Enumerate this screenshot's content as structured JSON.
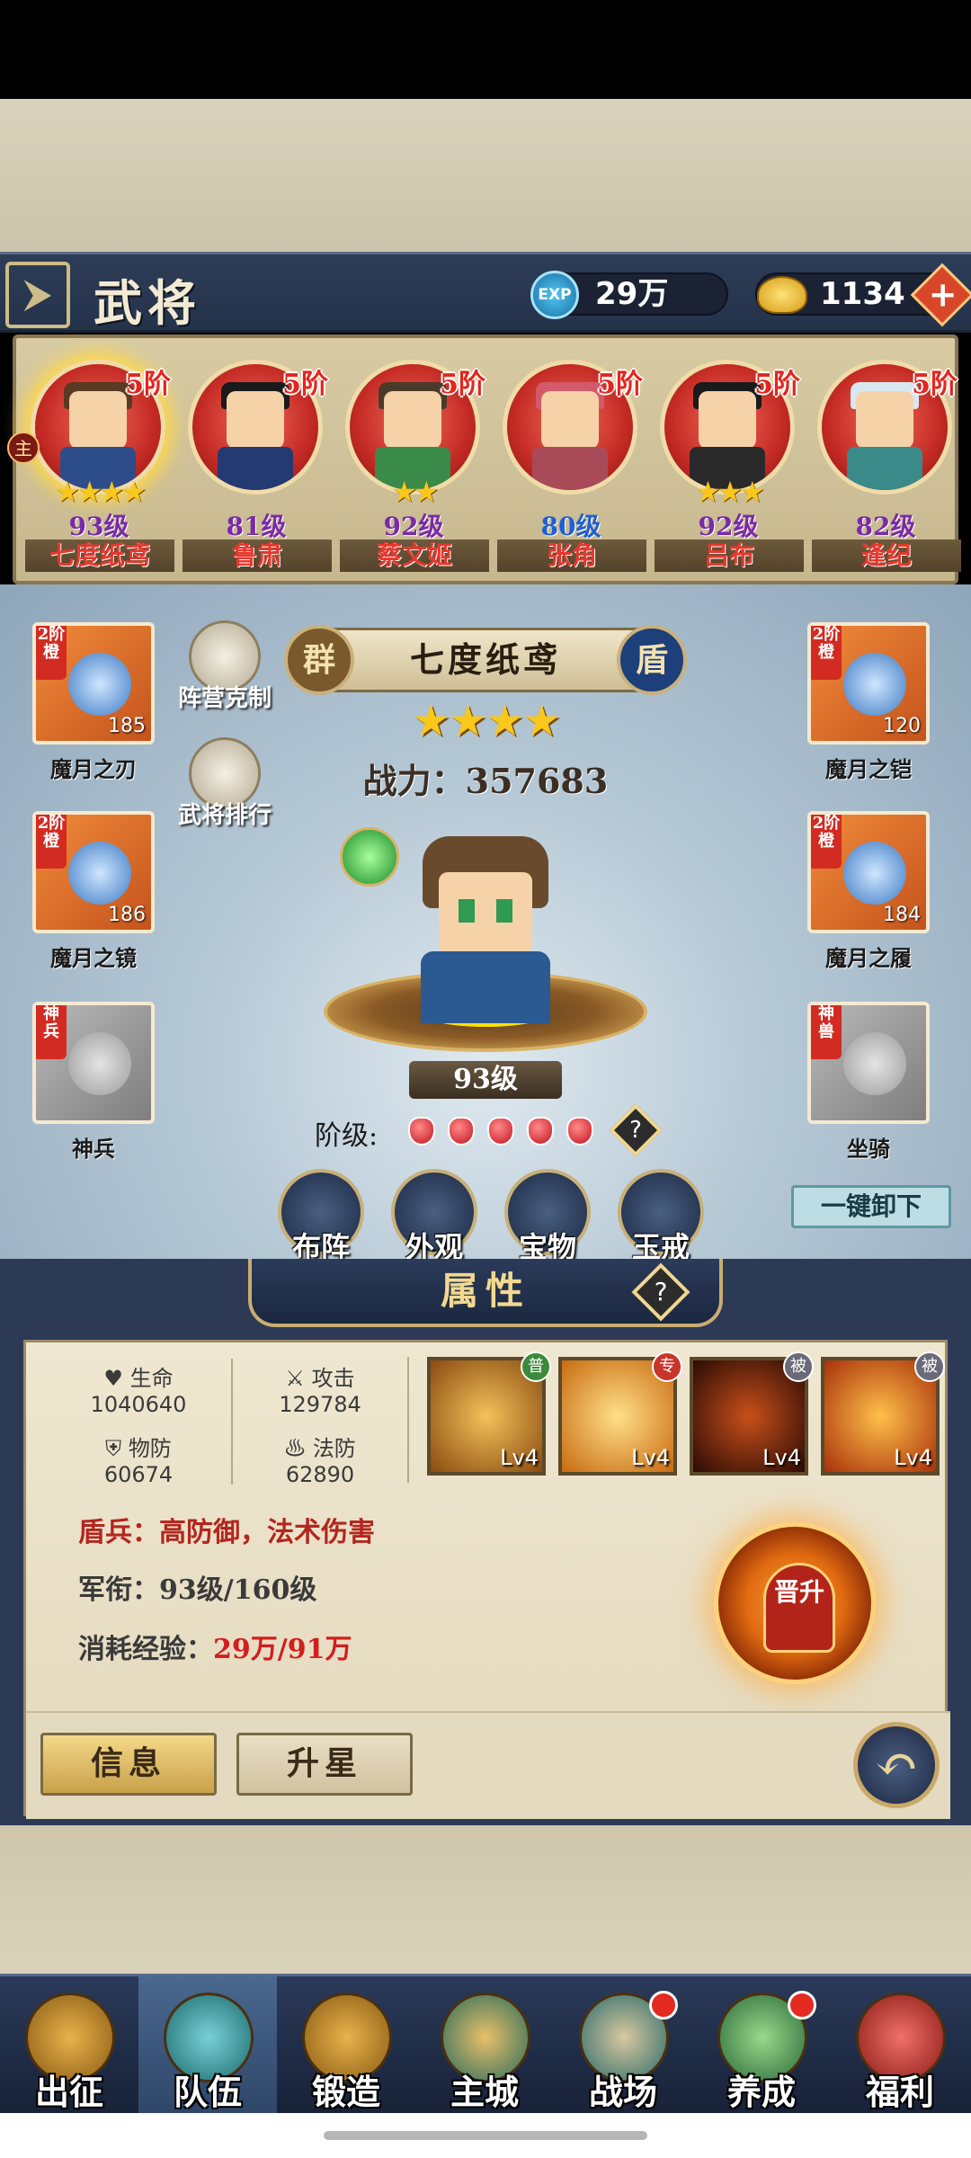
{
  "header": {
    "title": "武将"
  },
  "resources": {
    "exp_label": "EXP",
    "exp": "29万",
    "gold": "1134"
  },
  "roster": [
    {
      "name": "七度纸鸢",
      "level": "93级",
      "tier": "5阶",
      "stars": "★★★★",
      "level_color": "#7a2aa8",
      "selected": true,
      "main_badge": "主"
    },
    {
      "name": "鲁肃",
      "level": "81级",
      "tier": "5阶",
      "stars": "",
      "level_color": "#7a2aa8"
    },
    {
      "name": "蔡文姬",
      "level": "92级",
      "tier": "5阶",
      "stars": "★★",
      "level_color": "#7a2aa8"
    },
    {
      "name": "张角",
      "level": "80级",
      "tier": "5阶",
      "stars": "",
      "level_color": "#1f5fd1"
    },
    {
      "name": "吕布",
      "level": "92级",
      "tier": "5阶",
      "stars": "★★★",
      "level_color": "#7a2aa8"
    },
    {
      "name": "逢纪",
      "level": "82级",
      "tier": "5阶",
      "stars": "",
      "level_color": "#7a2aa8"
    }
  ],
  "equipment": {
    "weapon": {
      "label": "魔月之刃",
      "tag": "2阶橙",
      "value": "185"
    },
    "mirror": {
      "label": "魔月之镜",
      "tag": "2阶橙",
      "value": "186"
    },
    "divine": {
      "label": "神兵",
      "tag": "神兵"
    },
    "armor": {
      "label": "魔月之铠",
      "tag": "2阶橙",
      "value": "120"
    },
    "boots": {
      "label": "魔月之履",
      "tag": "2阶橙",
      "value": "184"
    },
    "mount": {
      "label": "坐骑",
      "tag": "神兽"
    }
  },
  "side_buttons": {
    "restraint": "阵营克制",
    "ranking": "武将排行"
  },
  "selected_hero": {
    "faction": "群",
    "name": "七度纸鸢",
    "troop": "盾",
    "stars": "★★★★",
    "power_label": "战力：",
    "power": "357683",
    "level": "93级",
    "rank_label": "阶级:",
    "rank_gems": 5
  },
  "functions": {
    "formation": "布阵",
    "appearance": "外观",
    "treasure": "宝物",
    "ring": "玉戒"
  },
  "unequip_all": "一键卸下",
  "attributes": {
    "tab_title": "属性",
    "hp_label": "生命",
    "hp": "1040640",
    "atk_label": "攻击",
    "atk": "129784",
    "pdef_label": "物防",
    "pdef": "60674",
    "mdef_label": "法防",
    "mdef": "62890",
    "skills": [
      {
        "badge": "普",
        "badge_color": "#3c8a3c",
        "level": "Lv4"
      },
      {
        "badge": "专",
        "badge_color": "#c8362a",
        "level": "Lv4"
      },
      {
        "badge": "被",
        "badge_color": "#6a6a7a",
        "level": "Lv4"
      },
      {
        "badge": "被",
        "badge_color": "#6a6a7a",
        "level": "Lv4"
      }
    ],
    "troop_desc": "盾兵：高防御，法术伤害",
    "rank_desc_label": "军衔：",
    "rank_desc": "93级/160级",
    "exp_label": "消耗经验：",
    "exp_cost": "29万/91万",
    "promote": "晋升"
  },
  "bottom_tabs": {
    "info": "信息",
    "star_up": "升星"
  },
  "nav": [
    {
      "label": "出征"
    },
    {
      "label": "队伍",
      "active": true
    },
    {
      "label": "锻造"
    },
    {
      "label": "主城"
    },
    {
      "label": "战场",
      "dot": true
    },
    {
      "label": "养成",
      "dot": true
    },
    {
      "label": "福利"
    }
  ]
}
